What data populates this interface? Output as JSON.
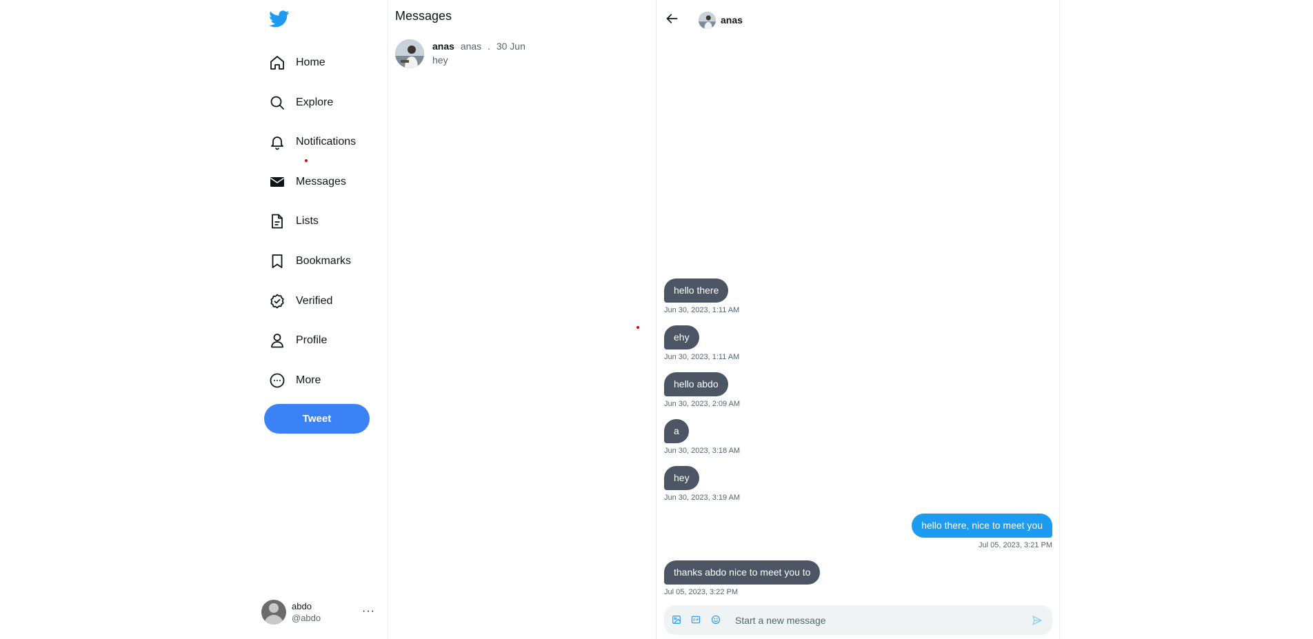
{
  "sidebar": {
    "logo_icon": "twitter-bird-icon",
    "brand_color": "#1d9bf0",
    "items": [
      {
        "label": "Home",
        "icon": "home-icon"
      },
      {
        "label": "Explore",
        "icon": "search-icon"
      },
      {
        "label": "Notifications",
        "icon": "bell-icon"
      },
      {
        "label": "Messages",
        "icon": "envelope-icon"
      },
      {
        "label": "Lists",
        "icon": "list-document-icon"
      },
      {
        "label": "Bookmarks",
        "icon": "bookmark-icon"
      },
      {
        "label": "Verified",
        "icon": "verified-check-icon"
      },
      {
        "label": "Profile",
        "icon": "person-icon"
      },
      {
        "label": "More",
        "icon": "more-circle-icon"
      }
    ],
    "tweet_button": "Tweet",
    "tweet_button_color": "#3b82f6",
    "account": {
      "name": "abdo",
      "handle": "@abdo",
      "more": "···"
    }
  },
  "messages_list": {
    "title": "Messages",
    "conversations": [
      {
        "name": "anas",
        "handle": "anas",
        "separator": ".",
        "date": "30 Jun",
        "preview": "hey"
      }
    ]
  },
  "chat": {
    "back_icon": "arrow-left-icon",
    "contact_name": "anas",
    "messages": [
      {
        "text": "hello there",
        "time": "Jun 30, 2023, 1:11 AM",
        "direction": "incoming"
      },
      {
        "text": "ehy",
        "time": "Jun 30, 2023, 1:11 AM",
        "direction": "incoming"
      },
      {
        "text": "hello abdo",
        "time": "Jun 30, 2023, 2:09 AM",
        "direction": "incoming"
      },
      {
        "text": "a",
        "time": "Jun 30, 2023, 3:18 AM",
        "direction": "incoming"
      },
      {
        "text": "hey",
        "time": "Jun 30, 2023, 3:19 AM",
        "direction": "incoming"
      },
      {
        "text": "hello there, nice to meet you",
        "time": "Jul 05, 2023, 3:21 PM",
        "direction": "outgoing"
      },
      {
        "text": "thanks abdo nice to meet you to",
        "time": "Jul 05, 2023, 3:22 PM",
        "direction": "incoming"
      }
    ],
    "incoming_color": "#4b5563",
    "outgoing_color": "#1d9bf0",
    "composer": {
      "placeholder": "Start a new message",
      "value": "",
      "tools": [
        "image-icon",
        "gif-icon",
        "emoji-icon"
      ],
      "send_icon": "send-icon"
    }
  }
}
